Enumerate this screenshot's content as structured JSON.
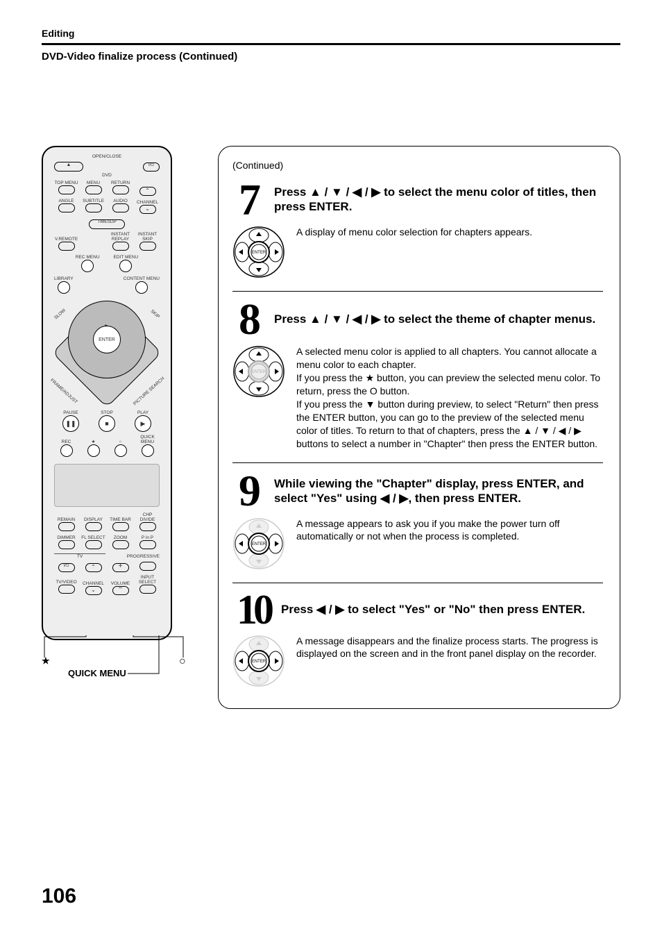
{
  "header": {
    "category": "Editing",
    "section": "DVD-Video finalize process (Continued)"
  },
  "remote": {
    "top": {
      "openclose": "OPEN/CLOSE",
      "eject": "▲",
      "power": "I/⏻",
      "dvd": "DVD",
      "topmenu": "TOP MENU",
      "menu": "MENU",
      "return": "RETURN",
      "angle": "ANGLE",
      "subtitle": "SUBTITLE",
      "audio": "AUDIO",
      "channel": "CHANNEL",
      "timeslip": "TIMESLIP",
      "vremote": "V.REMOTE",
      "instantreplay": "INSTANT REPLAY",
      "instantskip": "INSTANT SKIP",
      "recmenu": "REC MENU",
      "editmenu": "EDIT MENU",
      "library": "LIBRARY",
      "contentmenu": "CONTENT MENU"
    },
    "dpad": {
      "slow": "SLOW",
      "skip": "SKIP",
      "enter": "ENTER",
      "frameadjust": "FRAME/ADJUST",
      "picturesearch": "PICTURE SEARCH"
    },
    "transport": {
      "pause": "PAUSE",
      "stop": "STOP",
      "play": "PLAY",
      "rec": "REC",
      "star": "★",
      "circle": "○",
      "quickmenu": "QUICK MENU"
    },
    "bottom": {
      "remain": "REMAIN",
      "display": "DISPLAY",
      "timebar": "TIME BAR",
      "chpdivide": "CHP DIVIDE",
      "dimmer": "DIMMER",
      "flselect": "FL SELECT",
      "zoom": "ZOOM",
      "pinp": "P in P",
      "tv": "TV",
      "progressive": "PROGRESSIVE",
      "tvvideo": "TV/VIDEO",
      "channel": "CHANNEL",
      "volume": "VOLUME",
      "inputselect": "INPUT SELECT"
    }
  },
  "callouts": {
    "star": "★",
    "circle": "○",
    "quickmenu": "QUICK MENU"
  },
  "steps": {
    "continued": "(Continued)",
    "s7": {
      "num": "7",
      "title_pre": "Press ",
      "title_arrows": "▲ / ▼ / ◀ / ▶",
      "title_mid": " to select the menu color of titles, then press ENTER.",
      "body": "A display of menu color selection for chapters appears."
    },
    "s8": {
      "num": "8",
      "title_pre": "Press ",
      "title_arrows": "▲ / ▼ / ◀ / ▶",
      "title_mid": " to select the theme of chapter menus.",
      "body_l1": "A selected menu color is applied to all chapters. You cannot allocate a menu color to each chapter.",
      "body_l2a": "If you press the ",
      "body_l2star": "★",
      "body_l2b": " button, you can preview the selected menu color. To return, press the O button.",
      "body_l3a": "If you press the ",
      "body_l3down": "▼",
      "body_l3b": " button during preview, to select \"Return\" then press the ENTER button, you can go to the preview of the selected menu color of titles. To return to that of chapters, press the ",
      "body_l3arrows": "▲ / ▼ / ◀ / ▶",
      "body_l3c": " buttons to select a number in \"Chapter\" then press the ENTER button."
    },
    "s9": {
      "num": "9",
      "title_a": "While viewing the \"Chapter\" display, press ENTER, and select \"Yes\" using ",
      "title_arrows": "◀ / ▶",
      "title_b": ", then press ENTER.",
      "body": "A message appears to ask you if you make the power turn off automatically or not when the process is completed."
    },
    "s10": {
      "num": "10",
      "title_a": "Press ",
      "title_arrows": "◀ / ▶",
      "title_b": " to select \"Yes\" or \"No\" then press ENTER.",
      "body": "A message disappears and the finalize process starts. The progress is displayed on the screen and in the front panel display on the recorder."
    },
    "dpad_enter": "ENTER"
  },
  "page_number": "106"
}
